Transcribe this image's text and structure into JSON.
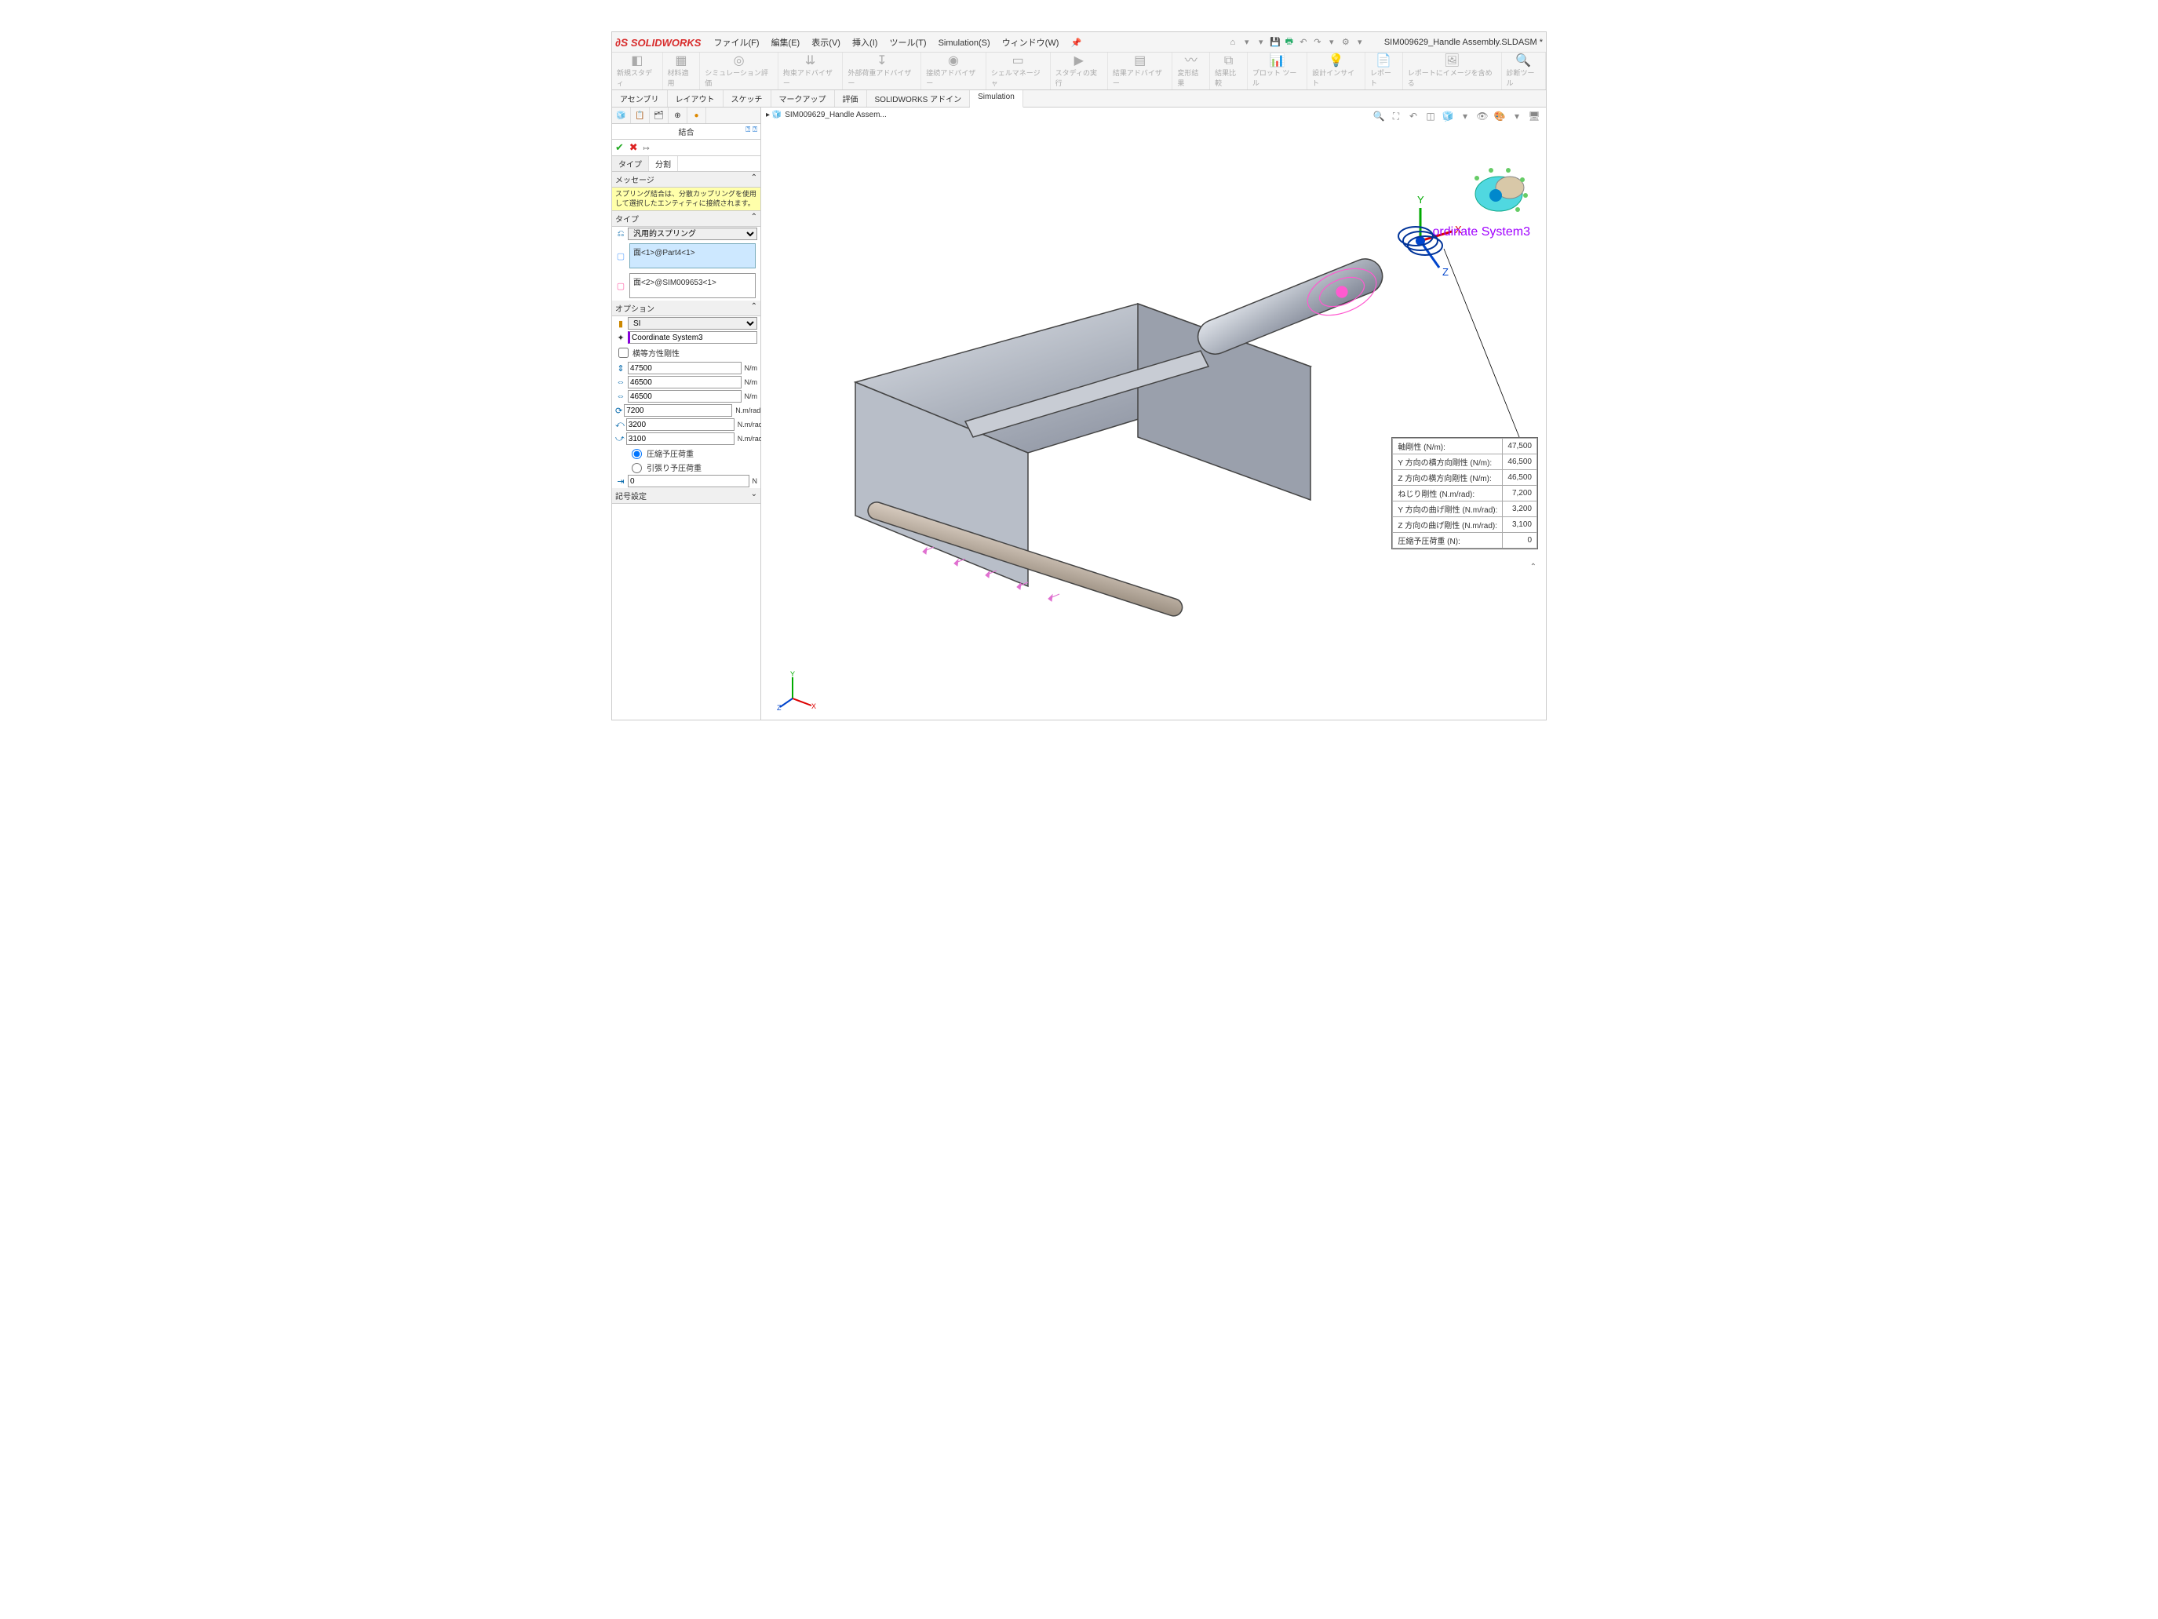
{
  "app": {
    "brand": "SOLIDWORKS",
    "docname": "SIM009629_Handle Assembly.SLDASM *"
  },
  "menus": [
    "ファイル(F)",
    "編集(E)",
    "表示(V)",
    "挿入(I)",
    "ツール(T)",
    "Simulation(S)",
    "ウィンドウ(W)"
  ],
  "ribbon": [
    "新規スタディ",
    "材料適用",
    "シミュレーション評価",
    "拘束アドバイザー",
    "外部荷重アドバイザー",
    "接続アドバイザー",
    "シェルマネージャ",
    "スタディの実行",
    "結果アドバイザー",
    "変形結果",
    "結果比較",
    "プロット ツール",
    "設計インサイト",
    "レポート",
    "レポートにイメージを含める",
    "診断ツール"
  ],
  "tabs": [
    "アセンブリ",
    "レイアウト",
    "スケッチ",
    "マークアップ",
    "評価",
    "SOLIDWORKS アドイン",
    "Simulation"
  ],
  "tabs_active": 6,
  "breadcrumb": "SIM009629_Handle Assem...",
  "panel": {
    "title": "結合",
    "subtabs": [
      "タイプ",
      "分割"
    ],
    "msg_head": "メッセージ",
    "msg": "スプリング結合は、分散カップリングを使用して選択したエンティティに接続されます。",
    "type_head": "タイプ",
    "type_value": "汎用的スプリング",
    "sel1": "面<1>@Part4<1>",
    "sel2": "面<2>@SIM009653<1>",
    "opt_head": "オプション",
    "units": "SI",
    "coord": "Coordinate System3",
    "aniso_label": "横等方性剛性",
    "stiff": [
      {
        "v": "47500",
        "u": "N/m"
      },
      {
        "v": "46500",
        "u": "N/m"
      },
      {
        "v": "46500",
        "u": "N/m"
      },
      {
        "v": "7200",
        "u": "N.m/rad"
      },
      {
        "v": "3200",
        "u": "N.m/rad"
      },
      {
        "v": "3100",
        "u": "N.m/rad"
      }
    ],
    "preload_comp": "圧縮予圧荷重",
    "preload_tens": "引張り予圧荷重",
    "preload_val": "0",
    "preload_unit": "N",
    "sym_head": "記号設定"
  },
  "callout": {
    "rows": [
      [
        "軸剛性 (N/m):",
        "47,500"
      ],
      [
        "Y 方向の横方向剛性 (N/m):",
        "46,500"
      ],
      [
        "Z 方向の横方向剛性 (N/m):",
        "46,500"
      ],
      [
        "ねじり剛性 (N.m/rad):",
        "7,200"
      ],
      [
        "Y 方向の曲げ剛性 (N.m/rad):",
        "3,200"
      ],
      [
        "Z 方向の曲げ剛性 (N.m/rad):",
        "3,100"
      ],
      [
        "圧縮予圧荷重 (N):",
        "0"
      ]
    ]
  },
  "coord_label": "ordinate System3"
}
